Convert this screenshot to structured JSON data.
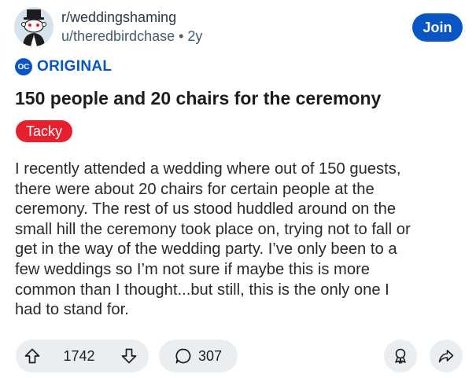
{
  "post": {
    "subreddit": "r/weddingshaming",
    "username": "u/theredbirdchase",
    "separator": "•",
    "age": "2y",
    "join_label": "Join",
    "oc_badge": "OC",
    "original_label": "ORIGINAL",
    "title": "150 people and 20 chairs for the ceremony",
    "flair": "Tacky",
    "body_lines": [
      "I recently attended a wedding where out of 150 guests,",
      "there were about 20 chairs for certain people at the",
      "ceremony. The rest of us stood huddled around on the",
      "small hill the ceremony took place on, trying not to fall or",
      "get in the way of the wedding party. I’ve only been to a",
      "few weddings so I’m not sure if maybe this is more",
      "common than I thought...but still, this is the only one I",
      "had to stand for."
    ]
  },
  "actions": {
    "upvotes": "1742",
    "comments": "307",
    "upvote_icon": "upvote-arrow-icon",
    "downvote_icon": "downvote-arrow-icon",
    "comment_icon": "comment-bubble-icon",
    "award_icon": "award-medal-icon",
    "share_icon": "share-arrow-icon"
  },
  "colors": {
    "accent_blue": "#0a55c6",
    "flair_red": "#e8202e",
    "pill_bg": "#ebeef1",
    "text": "#1c1c1c"
  }
}
